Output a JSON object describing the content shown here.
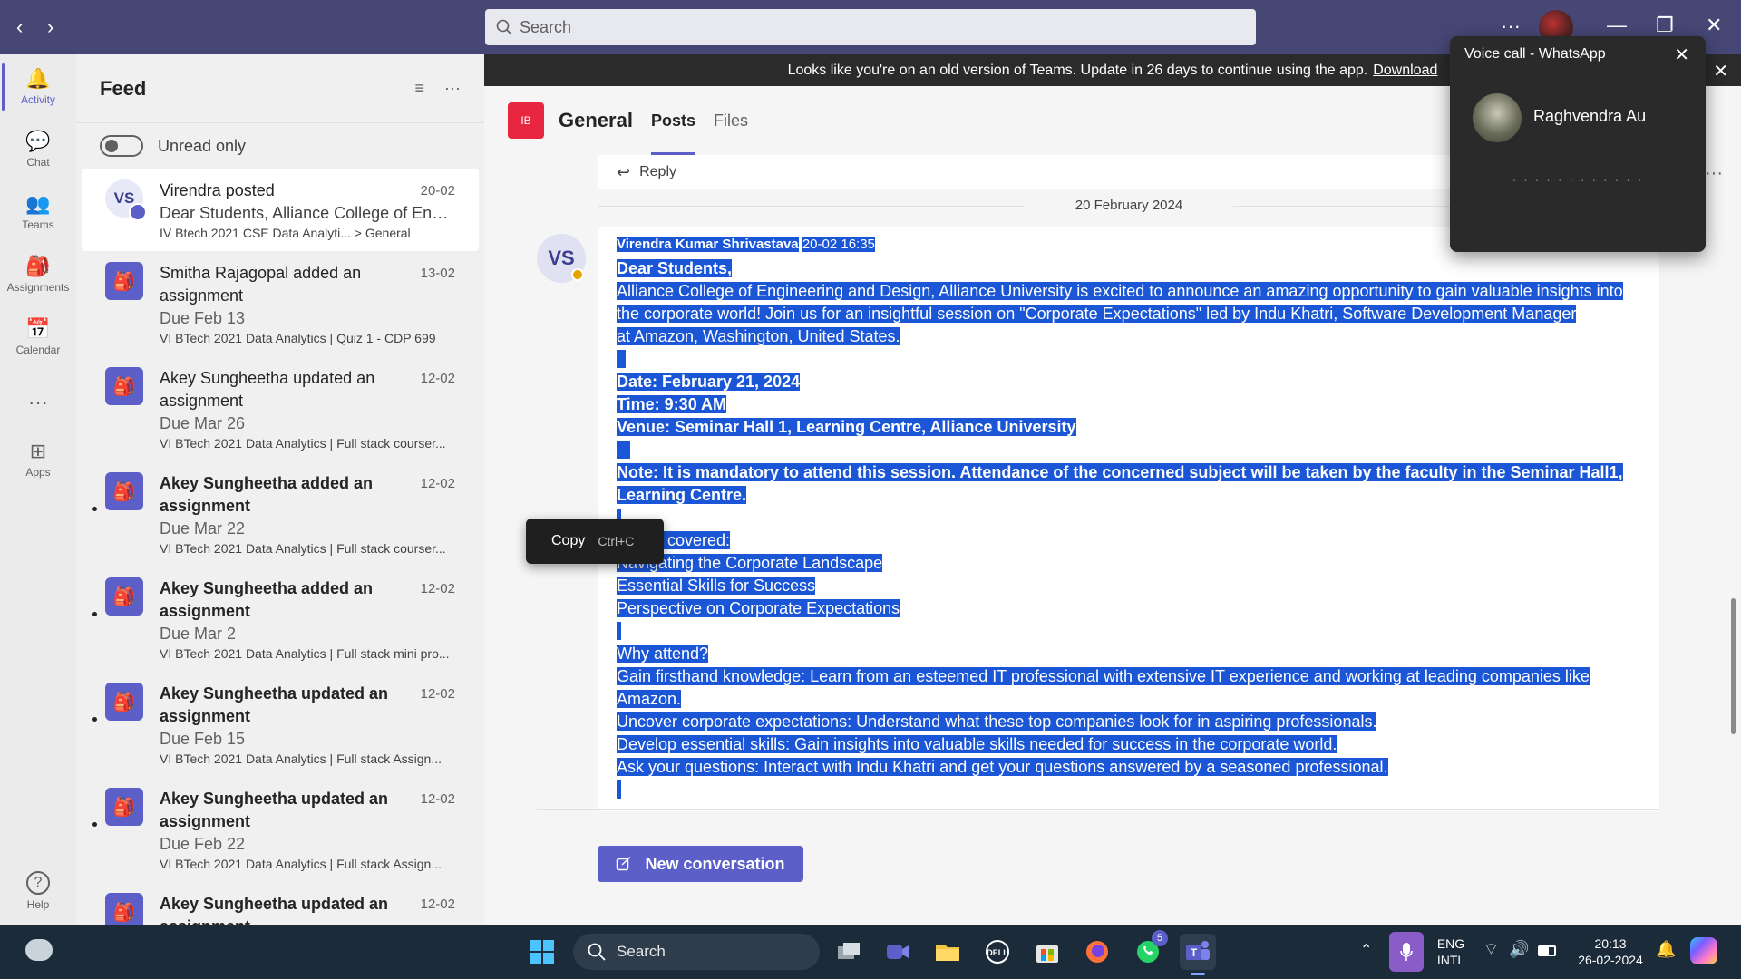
{
  "titlebar": {
    "back_icon": "‹",
    "forward_icon": "›",
    "search_placeholder": "Search",
    "more_label": "···",
    "minimize": "—",
    "maximize": "❐",
    "close": "✕"
  },
  "rail": [
    {
      "label": "Activity",
      "icon": "🔔",
      "name": "activity"
    },
    {
      "label": "Chat",
      "icon": "💬",
      "name": "chat"
    },
    {
      "label": "Teams",
      "icon": "👥",
      "name": "teams"
    },
    {
      "label": "Assignments",
      "icon": "🎒",
      "name": "assignments"
    },
    {
      "label": "Calendar",
      "icon": "📅",
      "name": "calendar"
    },
    {
      "label": "···",
      "icon": "",
      "name": "more"
    },
    {
      "label": "Apps",
      "icon": "⊞",
      "name": "apps"
    },
    {
      "label": "Help",
      "icon": "?",
      "name": "help"
    }
  ],
  "feed": {
    "title": "Feed",
    "filter_icon": "≡",
    "more_icon": "···",
    "unread_label": "Unread only",
    "items": [
      {
        "avatar": "VS",
        "title": "Virendra posted",
        "date": "20-02",
        "line1": "Dear Students, Alliance College of Engine...",
        "line2": "IV Btech 2021 CSE Data Analyti... > General",
        "bold": false
      },
      {
        "avatar": "",
        "title": "Smitha Rajagopal added an assignment",
        "date": "13-02",
        "line1": "Due Feb 13",
        "line2": "VI BTech 2021 Data Analytics | Quiz 1 - CDP 699",
        "bold": false
      },
      {
        "avatar": "",
        "title": "Akey Sungheetha updated an assignment",
        "date": "12-02",
        "line1": "Due Mar 26",
        "line2": "VI BTech 2021 Data Analytics | Full stack courser...",
        "bold": false
      },
      {
        "avatar": "",
        "title": "Akey Sungheetha added an assignment",
        "date": "12-02",
        "line1": "Due Mar 22",
        "line2": "VI BTech 2021 Data Analytics | Full stack courser...",
        "bold": true
      },
      {
        "avatar": "",
        "title": "Akey Sungheetha added an assignment",
        "date": "12-02",
        "line1": "Due Mar 2",
        "line2": "VI BTech 2021 Data Analytics | Full stack mini pro...",
        "bold": true
      },
      {
        "avatar": "",
        "title": "Akey Sungheetha updated an assignment",
        "date": "12-02",
        "line1": "Due Feb 15",
        "line2": "VI BTech 2021 Data Analytics | Full stack Assign...",
        "bold": true
      },
      {
        "avatar": "",
        "title": "Akey Sungheetha updated an assignment",
        "date": "12-02",
        "line1": "Due Feb 22",
        "line2": "VI BTech 2021 Data Analytics | Full stack Assign...",
        "bold": true
      },
      {
        "avatar": "",
        "title": "Akey Sungheetha updated an assignment",
        "date": "12-02",
        "line1": "",
        "line2": "",
        "bold": true
      }
    ]
  },
  "banner": {
    "text": "Looks like you're on an old version of Teams. Update in 26 days to continue using the app.",
    "link": "Download",
    "close": "✕"
  },
  "channel": {
    "logo": "IB",
    "name": "General",
    "tabs": [
      "Posts",
      "Files"
    ],
    "more": "···"
  },
  "reply_label": "Reply",
  "date_separator": "20 February 2024",
  "post": {
    "avatar": "VS",
    "author": "Virendra Kumar Shrivastava",
    "time": "20-02 16:35",
    "greeting": "Dear Students,",
    "intro1": "Alliance College of Engineering and Design, Alliance University is excited to announce an amazing opportunity to gain valuable insights into",
    "intro2": "the corporate world! Join us for an insightful session on \"Corporate Expectations\" led by Indu Khatri, Software Development Manager",
    "intro3": "at Amazon, Washington, United States.",
    "date": "Date: February 21, 2024",
    "time_line": "Time: 9:30 AM",
    "venue": "Venue: Seminar Hall 1, Learning Centre, Alliance University",
    "note1": "Note: It is mandatory to attend this session. Attendance of the concerned subject will be taken by the faculty in the Seminar Hall1,",
    "note2": "Learning Centre.",
    "topics_head": "Topics covered:",
    "topic1": "Navigating the Corporate Landscape",
    "topic2": "Essential Skills for Success",
    "topic3": "Perspective on Corporate Expectations",
    "why": "Why attend?",
    "why1a": "Gain firsthand knowledge: Learn from an esteemed IT professional with extensive IT experience and working at leading companies like",
    "why1b": "Amazon.",
    "why2": "Uncover corporate expectations: Understand what these top companies look for in aspiring professionals.",
    "why3": "Develop essential skills: Gain insights into valuable skills needed for success in the corporate world.",
    "why4": "Ask your questions: Interact with Indu Khatri and get your questions answered by a seasoned professional."
  },
  "context_menu": {
    "label": "Copy",
    "shortcut": "Ctrl+C"
  },
  "new_conversation": "New conversation",
  "whatsapp": {
    "title": "Voice call - WhatsApp",
    "close": "✕",
    "caller": "Raghvendra Au",
    "dots": "· · · · · · · · · · · ·"
  },
  "taskbar": {
    "search": "Search",
    "whatsapp_badge": "5",
    "lang1": "ENG",
    "lang2": "INTL",
    "time": "20:13",
    "date": "26-02-2024"
  }
}
